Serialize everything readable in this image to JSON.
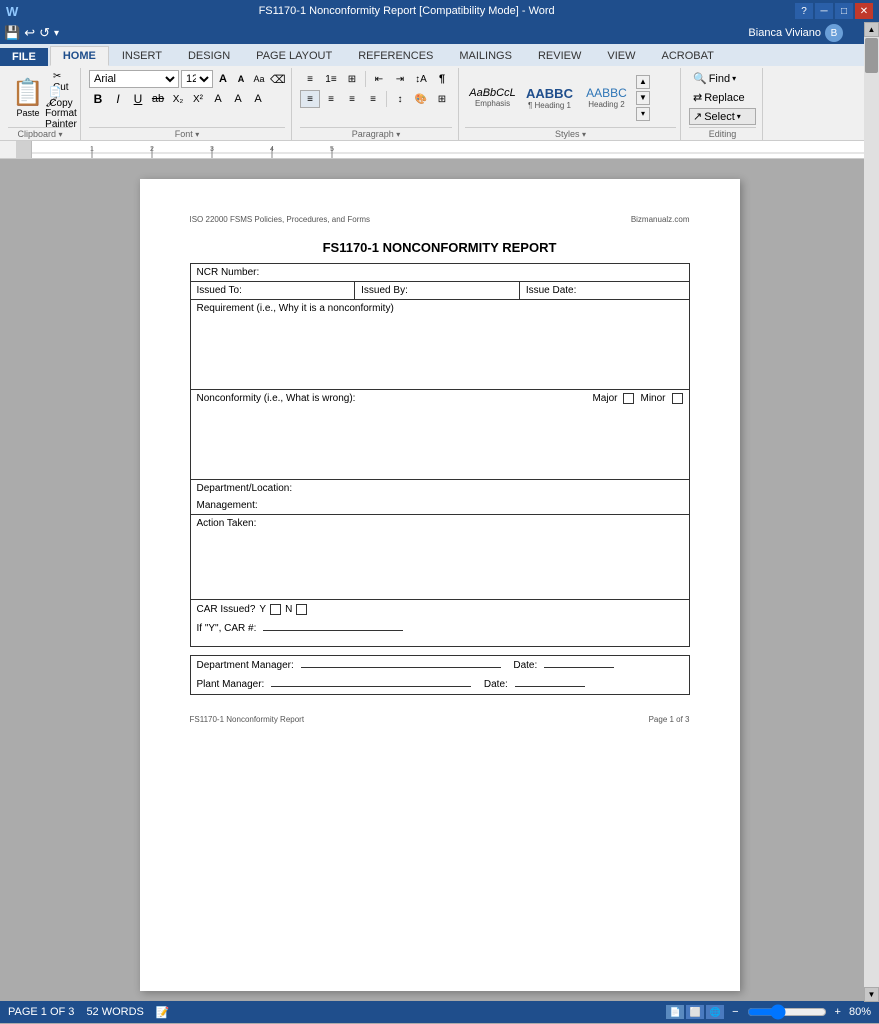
{
  "titlebar": {
    "title": "FS1170-1 Nonconformity Report [Compatibility Mode] - Word",
    "minimize": "─",
    "restore": "□",
    "close": "✕",
    "help": "?"
  },
  "qat": {
    "save_label": "💾",
    "undo_label": "↩",
    "redo_label": "↪",
    "customize_label": "▾"
  },
  "tabs": [
    "FILE",
    "HOME",
    "INSERT",
    "DESIGN",
    "PAGE LAYOUT",
    "REFERENCES",
    "MAILINGS",
    "REVIEW",
    "VIEW",
    "ACROBAT"
  ],
  "active_tab": "HOME",
  "user": {
    "name": "Bianca Viviano",
    "icon": "👤"
  },
  "font": {
    "face": "Arial",
    "size": "12",
    "grow": "A",
    "shrink": "A"
  },
  "styles": [
    {
      "label": "Emphasis",
      "preview": "AaBbCcL",
      "italic": true
    },
    {
      "label": "¶ Heading 1",
      "preview": "AABBCC",
      "bold": true
    },
    {
      "label": "Heading 2",
      "preview": "AABBCC"
    }
  ],
  "editing": {
    "find": "Find",
    "replace": "Replace",
    "select": "Select"
  },
  "document": {
    "header_left": "ISO 22000 FSMS Policies, Procedures, and Forms",
    "header_right": "Bizmanualz.com",
    "title": "FS1170-1 NONCONFORMITY REPORT",
    "fields": {
      "ncr_label": "NCR Number:",
      "issued_to_label": "Issued To:",
      "issued_by_label": "Issued By:",
      "issue_date_label": "Issue Date:",
      "requirement_label": "Requirement (i.e., Why it is a nonconformity)",
      "nonconformity_label": "Nonconformity (i.e., What is wrong):",
      "major_label": "Major",
      "minor_label": "Minor",
      "dept_location_label": "Department/Location:",
      "management_label": "Management:",
      "action_taken_label": "Action Taken:",
      "car_issued_label": "CAR Issued?",
      "car_y_label": "Y",
      "car_n_label": "N",
      "car_if_y_label": "If \"Y\", CAR #:",
      "car_line": "___________________",
      "dept_manager_label": "Department Manager:",
      "dept_manager_line": "_______________________________________________",
      "date1_label": "Date:",
      "date1_line": "__________",
      "plant_manager_label": "Plant Manager:",
      "plant_manager_line": "_______________________________________________",
      "date2_label": "Date:",
      "date2_line": "__________"
    }
  },
  "footer": {
    "left": "FS1170-1 Nonconformity Report",
    "right": "Page 1 of 3"
  },
  "statusbar": {
    "page_info": "PAGE 1 OF 3",
    "words": "52 WORDS",
    "view_icon": "📄",
    "zoom_percent": "80%",
    "zoom_value": 80
  }
}
